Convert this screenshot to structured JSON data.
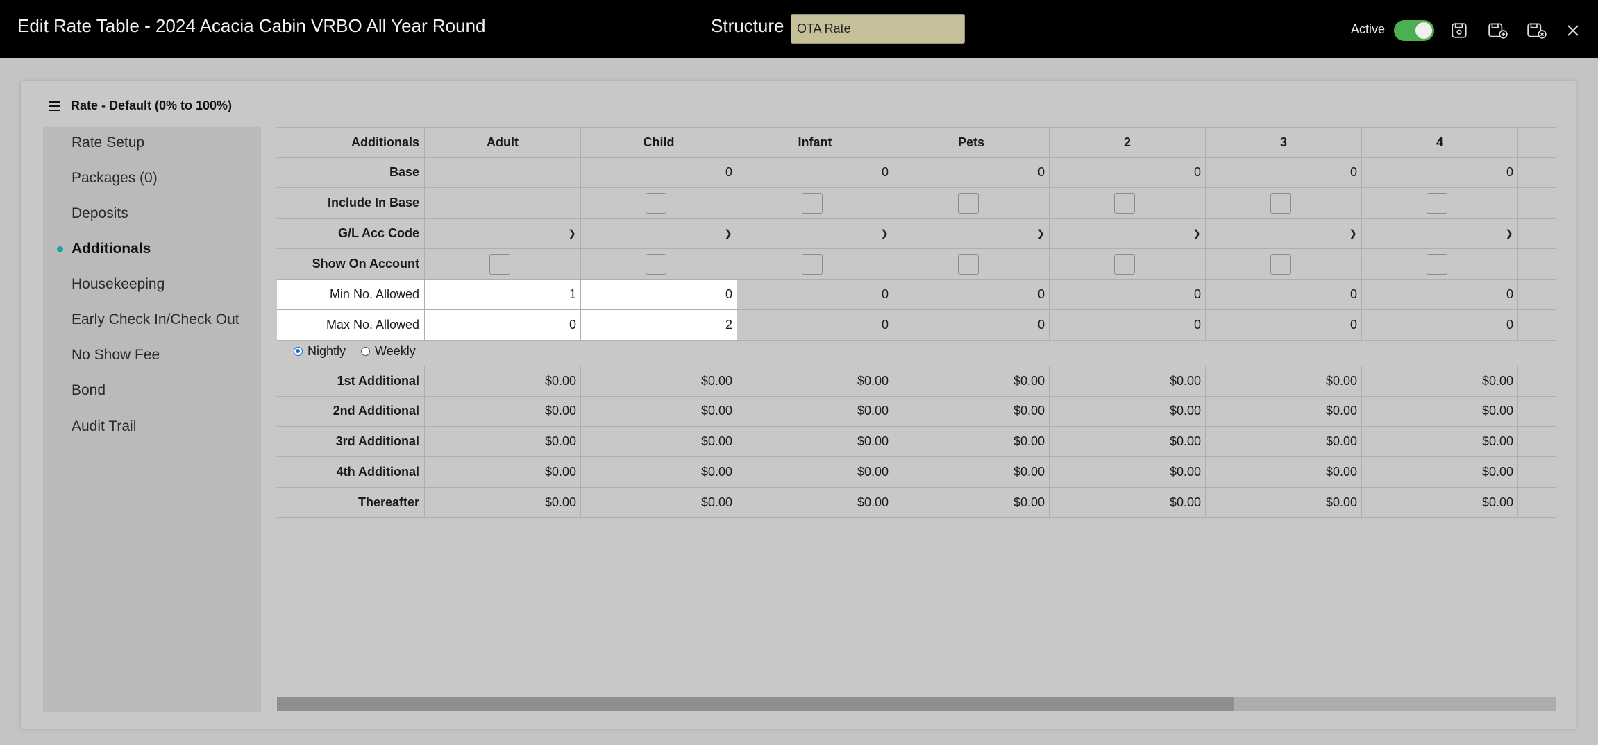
{
  "header": {
    "title": "Edit Rate Table - 2024 Acacia Cabin VRBO All Year Round",
    "structure_label": "Structure",
    "structure_value": "OTA Rate",
    "active_label": "Active",
    "active_on": true,
    "icons": [
      "save-icon",
      "save-and-new-icon",
      "save-and-close-icon",
      "close-icon"
    ]
  },
  "panel": {
    "heading": "Rate - Default (0% to 100%)"
  },
  "sidebar": {
    "items": [
      {
        "label": "Rate Setup"
      },
      {
        "label": "Packages (0)"
      },
      {
        "label": "Deposits"
      },
      {
        "label": "Additionals",
        "active": true
      },
      {
        "label": "Housekeeping"
      },
      {
        "label": "Early Check In/Check Out"
      },
      {
        "label": "No Show Fee"
      },
      {
        "label": "Bond"
      },
      {
        "label": "Audit Trail"
      }
    ]
  },
  "table": {
    "header_label": "Additionals",
    "columns": [
      "Adult",
      "Child",
      "Infant",
      "Pets",
      "2",
      "3",
      "4"
    ],
    "rows": {
      "base": {
        "label": "Base",
        "values": [
          "",
          "0",
          "0",
          "0",
          "0",
          "0",
          "0"
        ]
      },
      "include_in_base": {
        "label": "Include In Base"
      },
      "gl_acc_code": {
        "label": "G/L Acc Code"
      },
      "show_on_account": {
        "label": "Show On Account"
      },
      "min_allowed": {
        "label": "Min No. Allowed",
        "values": [
          "1",
          "0",
          "0",
          "0",
          "0",
          "0",
          "0"
        ]
      },
      "max_allowed": {
        "label": "Max No. Allowed",
        "values": [
          "0",
          "2",
          "0",
          "0",
          "0",
          "0",
          "0"
        ]
      }
    },
    "frequency": {
      "nightly": "Nightly",
      "weekly": "Weekly",
      "selected": "nightly"
    },
    "additional_rows": [
      {
        "label": "1st Additional",
        "values": [
          "$0.00",
          "$0.00",
          "$0.00",
          "$0.00",
          "$0.00",
          "$0.00",
          "$0.00"
        ]
      },
      {
        "label": "2nd Additional",
        "values": [
          "$0.00",
          "$0.00",
          "$0.00",
          "$0.00",
          "$0.00",
          "$0.00",
          "$0.00"
        ]
      },
      {
        "label": "3rd Additional",
        "values": [
          "$0.00",
          "$0.00",
          "$0.00",
          "$0.00",
          "$0.00",
          "$0.00",
          "$0.00"
        ]
      },
      {
        "label": "4th Additional",
        "values": [
          "$0.00",
          "$0.00",
          "$0.00",
          "$0.00",
          "$0.00",
          "$0.00",
          "$0.00"
        ]
      },
      {
        "label": "Thereafter",
        "values": [
          "$0.00",
          "$0.00",
          "$0.00",
          "$0.00",
          "$0.00",
          "$0.00",
          "$0.00"
        ]
      }
    ]
  }
}
